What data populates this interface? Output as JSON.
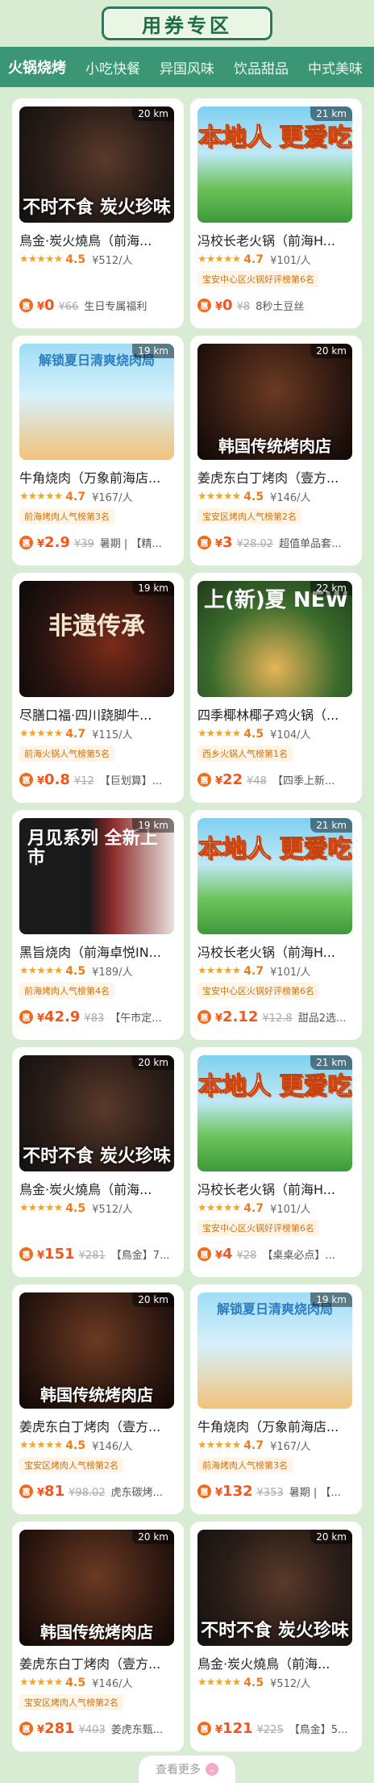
{
  "header": {
    "title": "用券专区"
  },
  "tabs": [
    {
      "label": "火锅烧烤",
      "active": true
    },
    {
      "label": "小吃快餐",
      "active": false
    },
    {
      "label": "异国风味",
      "active": false
    },
    {
      "label": "饮品甜品",
      "active": false
    },
    {
      "label": "中式美味",
      "active": false
    }
  ],
  "icons": {
    "coupon": "惠",
    "star": "★★★★★",
    "chevron": "⌄"
  },
  "cards": [
    {
      "theme": "th-dark",
      "thumb_text": "不时不食 炭火珍味",
      "distance": "20 km",
      "name": "鳥金·炭火燒鳥（前海...",
      "score": "4.5",
      "avg": "¥512/人",
      "tag": "",
      "currency": "¥",
      "price": "0",
      "original": "¥66",
      "desc": "生日专属福利"
    },
    {
      "theme": "th-green",
      "thumb_text": "本地人 更爱吃",
      "distance": "21 km",
      "name": "冯校长老火锅（前海H...",
      "score": "4.7",
      "avg": "¥101/人",
      "tag": "宝安中心区火锅好评榜第6名",
      "currency": "¥",
      "price": "0",
      "original": "¥8",
      "desc": "8秒土豆丝"
    },
    {
      "theme": "th-sky",
      "thumb_text": "解锁夏日清爽烧肉局",
      "distance": "19 km",
      "name": "牛角烧肉（万象前海店...",
      "score": "4.7",
      "avg": "¥167/人",
      "tag": "前海烤肉人气榜第3名",
      "currency": "¥",
      "price": "2.9",
      "original": "¥39",
      "desc": "暑期 | 【精..."
    },
    {
      "theme": "th-korea",
      "thumb_text": "韩国传统烤肉店",
      "distance": "20 km",
      "name": "姜虎东白丁烤肉（壹方...",
      "score": "4.5",
      "avg": "¥146/人",
      "tag": "宝安区烤肉人气榜第2名",
      "currency": "¥",
      "price": "3",
      "original": "¥28.02",
      "desc": "超值单品套..."
    },
    {
      "theme": "th-ink",
      "thumb_text": "非遗传承",
      "distance": "19 km",
      "name": "尽膳口福·四川跷脚牛...",
      "score": "4.7",
      "avg": "¥115/人",
      "tag": "前海火锅人气榜第5名",
      "currency": "¥",
      "price": "0.8",
      "original": "¥12",
      "desc": "【巨划算】..."
    },
    {
      "theme": "th-coco",
      "thumb_text": "上(新)夏 NEW",
      "distance": "22 km",
      "name": "四季椰林椰子鸡火锅（...",
      "score": "4.5",
      "avg": "¥104/人",
      "tag": "西乡火锅人气榜第1名",
      "currency": "¥",
      "price": "22",
      "original": "¥48",
      "desc": "【四季上新..."
    },
    {
      "theme": "th-beef",
      "thumb_text": "月见系列 全新上市",
      "distance": "19 km",
      "name": "黑旨烧肉（前海卓悦IN...",
      "score": "4.5",
      "avg": "¥189/人",
      "tag": "前海烤肉人气榜第4名",
      "currency": "¥",
      "price": "42.9",
      "original": "¥83",
      "desc": "【午市定..."
    },
    {
      "theme": "th-green",
      "thumb_text": "本地人 更爱吃",
      "distance": "21 km",
      "name": "冯校长老火锅（前海H...",
      "score": "4.7",
      "avg": "¥101/人",
      "tag": "宝安中心区火锅好评榜第6名",
      "currency": "¥",
      "price": "2.12",
      "original": "¥12.8",
      "desc": "甜品2选..."
    },
    {
      "theme": "th-dark",
      "thumb_text": "不时不食 炭火珍味",
      "distance": "20 km",
      "name": "鳥金·炭火燒鳥（前海...",
      "score": "4.5",
      "avg": "¥512/人",
      "tag": "",
      "currency": "¥",
      "price": "151",
      "original": "¥281",
      "desc": "【鳥金】7..."
    },
    {
      "theme": "th-green",
      "thumb_text": "本地人 更爱吃",
      "distance": "21 km",
      "name": "冯校长老火锅（前海H...",
      "score": "4.7",
      "avg": "¥101/人",
      "tag": "宝安中心区火锅好评榜第6名",
      "currency": "¥",
      "price": "4",
      "original": "¥28",
      "desc": "【桌桌必点】..."
    },
    {
      "theme": "th-korea",
      "thumb_text": "韩国传统烤肉店",
      "distance": "20 km",
      "name": "姜虎东白丁烤肉（壹方...",
      "score": "4.5",
      "avg": "¥146/人",
      "tag": "宝安区烤肉人气榜第2名",
      "currency": "¥",
      "price": "81",
      "original": "¥98.02",
      "desc": "虎东碳烤..."
    },
    {
      "theme": "th-sky",
      "thumb_text": "解锁夏日清爽烧肉局",
      "distance": "19 km",
      "name": "牛角烧肉（万象前海店...",
      "score": "4.7",
      "avg": "¥167/人",
      "tag": "前海烤肉人气榜第3名",
      "currency": "¥",
      "price": "132",
      "original": "¥353",
      "desc": "暑期 | 【..."
    },
    {
      "theme": "th-korea",
      "thumb_text": "韩国传统烤肉店",
      "distance": "20 km",
      "name": "姜虎东白丁烤肉（壹方...",
      "score": "4.5",
      "avg": "¥146/人",
      "tag": "宝安区烤肉人气榜第2名",
      "currency": "¥",
      "price": "281",
      "original": "¥403",
      "desc": "姜虎东甄..."
    },
    {
      "theme": "th-dark",
      "thumb_text": "不时不食 炭火珍味",
      "distance": "20 km",
      "name": "鳥金·炭火燒鳥（前海...",
      "score": "4.5",
      "avg": "¥512/人",
      "tag": "",
      "currency": "¥",
      "price": "121",
      "original": "¥225",
      "desc": "【鳥金】5..."
    }
  ],
  "more_button": {
    "label": "查看更多"
  }
}
